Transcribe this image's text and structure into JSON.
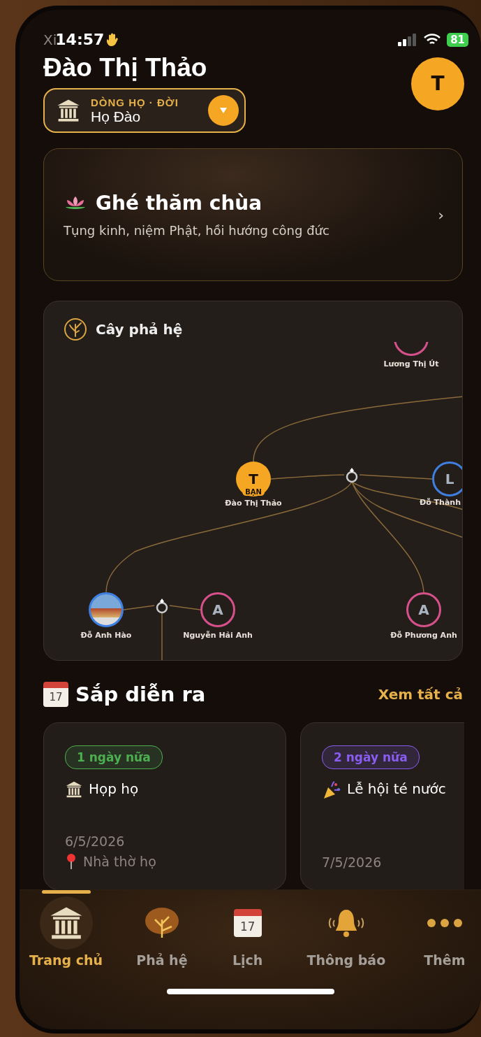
{
  "status_bar": {
    "carrier": "Xi",
    "time": "14:57",
    "battery": "81"
  },
  "header": {
    "title": "Đào Thị Thảo",
    "avatar_letter": "T",
    "lineage": {
      "label": "DÒNG HỌ · ĐỜI",
      "value": "Họ Đào"
    }
  },
  "banner": {
    "title": "Ghé thăm chùa",
    "subtitle": "Tụng kinh, niệm Phật, hồi hướng công đức",
    "chevron": "›"
  },
  "family_tree": {
    "title": "Cây phả hệ",
    "nodes": [
      {
        "kind": "letter",
        "name": "Lương Thị Út",
        "color": "#d6508c"
      },
      {
        "kind": "letter",
        "letter": "T",
        "name": "Đào Thị Thảo",
        "badge": "BẠN",
        "color": "#f5a623"
      },
      {
        "kind": "letter",
        "letter": "L",
        "name": "Đỗ Thành",
        "color": "#3f7fe0"
      },
      {
        "kind": "photo",
        "name": "Đỗ Anh Hào",
        "color": "#3f7fe0"
      },
      {
        "kind": "letter",
        "letter": "A",
        "name": "Nguyễn Hải Anh",
        "color": "#d6508c"
      },
      {
        "kind": "letter",
        "letter": "A",
        "name": "Đỗ Phương Anh",
        "color": "#d6508c"
      }
    ]
  },
  "upcoming": {
    "title": "Sắp diễn ra",
    "icon_day": "17",
    "see_all": "Xem tất cả",
    "events": [
      {
        "kind": "temple",
        "badge": "1 ngày nữa",
        "color": "#4caf50",
        "title": "Họp họ",
        "date": "6/5/2026",
        "location": "Nhà thờ họ"
      },
      {
        "kind": "party",
        "badge": "2 ngày nữa",
        "color": "#8a5cf0",
        "title": "Lễ hội té nước",
        "date": "7/5/2026"
      }
    ]
  },
  "tabs": [
    {
      "kind": "home",
      "label": "Trang chủ",
      "selected": true
    },
    {
      "kind": "tree",
      "label": "Phả hệ",
      "selected": false
    },
    {
      "kind": "calendar",
      "label": "Lịch",
      "icon_day": "17",
      "selected": false
    },
    {
      "kind": "bell",
      "label": "Thông báo",
      "selected": false
    },
    {
      "kind": "more",
      "label": "Thêm",
      "selected": false
    }
  ]
}
